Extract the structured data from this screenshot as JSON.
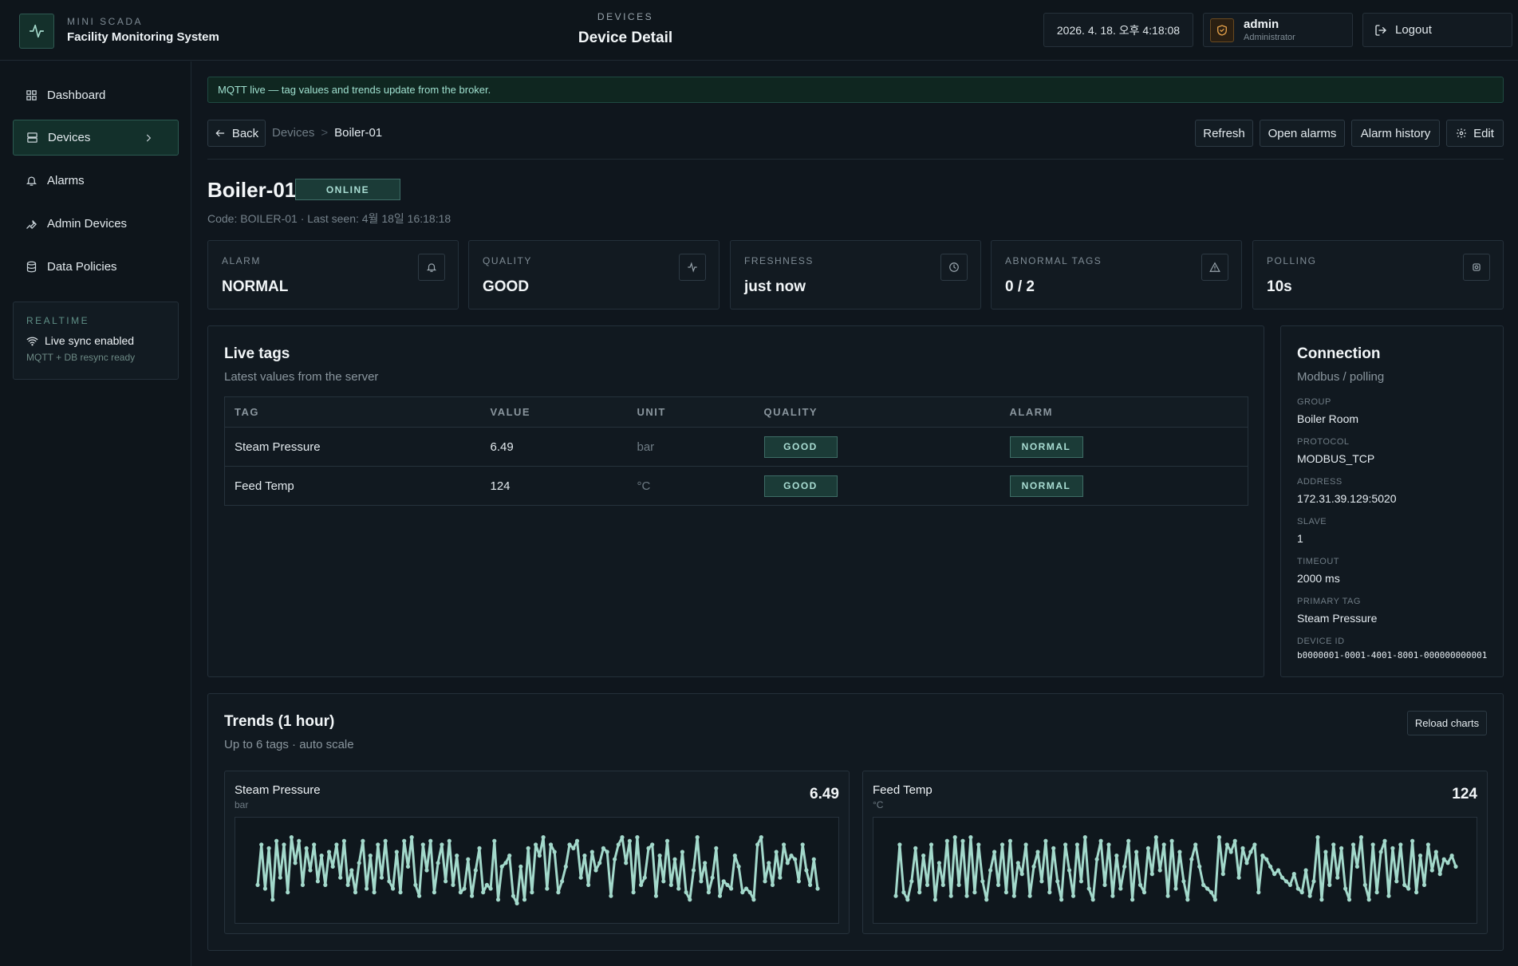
{
  "header": {
    "brand_small": "MINI SCADA",
    "brand_name": "Facility Monitoring System",
    "section": "DEVICES",
    "page_title": "Device Detail",
    "clock": "2026. 4. 18. 오후 4:18:08",
    "user_name": "admin",
    "user_role": "Administrator",
    "logout_label": "Logout"
  },
  "sidebar": {
    "items": [
      {
        "label": "Dashboard",
        "icon": "grid-icon"
      },
      {
        "label": "Devices",
        "icon": "server-icon",
        "active": true
      },
      {
        "label": "Alarms",
        "icon": "bell-icon"
      },
      {
        "label": "Admin Devices",
        "icon": "wrench-icon"
      },
      {
        "label": "Data Policies",
        "icon": "database-icon"
      }
    ],
    "realtime": {
      "title": "REALTIME",
      "status": "Live sync enabled",
      "detail": "MQTT + DB resync ready"
    }
  },
  "banner": "MQTT live — tag values and trends update from the broker.",
  "toolbar": {
    "back": "Back",
    "crumb_parent": "Devices",
    "crumb_sep": ">",
    "crumb_current": "Boiler-01",
    "refresh": "Refresh",
    "open_alarms": "Open alarms",
    "alarm_history": "Alarm history",
    "edit": "Edit"
  },
  "device": {
    "name": "Boiler-01",
    "status": "ONLINE",
    "subtitle": "Code: BOILER-01 · Last seen: 4월 18일 16:18:18"
  },
  "stats": [
    {
      "label": "ALARM",
      "value": "NORMAL",
      "icon": "bell-icon"
    },
    {
      "label": "QUALITY",
      "value": "GOOD",
      "icon": "activity-icon"
    },
    {
      "label": "FRESHNESS",
      "value": "just now",
      "icon": "clock-icon"
    },
    {
      "label": "ABNORMAL TAGS",
      "value": "0 / 2",
      "icon": "warning-icon"
    },
    {
      "label": "POLLING",
      "value": "10s",
      "icon": "gear-icon"
    }
  ],
  "live_tags": {
    "title": "Live tags",
    "subtitle": "Latest values from the server",
    "columns": [
      "TAG",
      "VALUE",
      "UNIT",
      "QUALITY",
      "ALARM"
    ],
    "rows": [
      {
        "tag": "Steam Pressure",
        "value": "6.49",
        "unit": "bar",
        "quality": "GOOD",
        "alarm": "NORMAL"
      },
      {
        "tag": "Feed Temp",
        "value": "124",
        "unit": "°C",
        "quality": "GOOD",
        "alarm": "NORMAL"
      }
    ]
  },
  "connection": {
    "title": "Connection",
    "subtitle": "Modbus / polling",
    "fields": [
      {
        "k": "GROUP",
        "v": "Boiler Room"
      },
      {
        "k": "PROTOCOL",
        "v": "MODBUS_TCP"
      },
      {
        "k": "ADDRESS",
        "v": "172.31.39.129:5020"
      },
      {
        "k": "SLAVE",
        "v": "1"
      },
      {
        "k": "TIMEOUT",
        "v": "2000 ms"
      },
      {
        "k": "PRIMARY TAG",
        "v": "Steam Pressure"
      },
      {
        "k": "DEVICE ID",
        "v": "b0000001-0001-4001-8001-000000000001"
      }
    ]
  },
  "trends": {
    "title": "Trends (1 hour)",
    "subtitle": "Up to 6 tags · auto scale",
    "reload": "Reload charts",
    "line_color": "#a3d9cb"
  },
  "chart_data": [
    {
      "type": "line",
      "title": "Steam Pressure",
      "unit": "bar",
      "current": "6.49",
      "values": [
        0.3,
        0.85,
        0.25,
        0.8,
        0.1,
        0.9,
        0.4,
        0.85,
        0.2,
        0.95,
        0.6,
        0.9,
        0.3,
        0.8,
        0.5,
        0.85,
        0.35,
        0.7,
        0.3,
        0.75,
        0.55,
        0.85,
        0.4,
        0.9,
        0.3,
        0.5,
        0.2,
        0.6,
        0.9,
        0.25,
        0.7,
        0.2,
        0.85,
        0.4,
        0.9,
        0.35,
        0.25,
        0.75,
        0.2,
        0.9,
        0.55,
        0.95,
        0.3,
        0.15,
        0.85,
        0.5,
        0.9,
        0.2,
        0.6,
        0.85,
        0.35,
        0.9,
        0.3,
        0.7,
        0.2,
        0.25,
        0.65,
        0.15,
        0.5,
        0.8,
        0.2,
        0.3,
        0.25,
        0.9,
        0.1,
        0.55,
        0.6,
        0.7,
        0.15,
        0.05,
        0.55,
        0.1,
        0.8,
        0.2,
        0.85,
        0.7,
        0.95,
        0.25,
        0.85,
        0.75,
        0.2,
        0.35,
        0.55,
        0.85,
        0.8,
        0.9,
        0.4,
        0.7,
        0.3,
        0.75,
        0.5,
        0.6,
        0.8,
        0.75,
        0.15,
        0.65,
        0.85,
        0.95,
        0.6,
        0.9,
        0.2,
        0.95,
        0.3,
        0.4,
        0.8,
        0.85,
        0.15,
        0.7,
        0.35,
        0.9,
        0.3,
        0.65,
        0.25,
        0.75,
        0.2,
        0.1,
        0.5,
        0.95,
        0.35,
        0.6,
        0.2,
        0.4,
        0.8,
        0.15,
        0.35,
        0.3,
        0.25,
        0.7,
        0.55,
        0.2,
        0.25,
        0.2,
        0.1,
        0.85,
        0.95,
        0.35,
        0.6,
        0.3,
        0.75,
        0.4,
        0.85,
        0.6,
        0.7,
        0.65,
        0.35,
        0.85,
        0.5,
        0.3,
        0.65,
        0.25
      ]
    },
    {
      "type": "line",
      "title": "Feed Temp",
      "unit": "°C",
      "current": "124",
      "values": [
        0.15,
        0.85,
        0.2,
        0.1,
        0.35,
        0.8,
        0.2,
        0.7,
        0.3,
        0.85,
        0.1,
        0.6,
        0.3,
        0.9,
        0.15,
        0.95,
        0.3,
        0.9,
        0.15,
        0.95,
        0.2,
        0.85,
        0.35,
        0.1,
        0.5,
        0.75,
        0.3,
        0.85,
        0.2,
        0.9,
        0.15,
        0.6,
        0.45,
        0.85,
        0.15,
        0.55,
        0.75,
        0.35,
        0.9,
        0.2,
        0.8,
        0.35,
        0.1,
        0.85,
        0.5,
        0.15,
        0.85,
        0.35,
        0.95,
        0.25,
        0.1,
        0.65,
        0.9,
        0.3,
        0.85,
        0.15,
        0.7,
        0.25,
        0.55,
        0.9,
        0.1,
        0.75,
        0.3,
        0.2,
        0.8,
        0.45,
        0.95,
        0.5,
        0.85,
        0.15,
        0.9,
        0.25,
        0.75,
        0.35,
        0.1,
        0.65,
        0.85,
        0.55,
        0.3,
        0.25,
        0.2,
        0.1,
        0.95,
        0.45,
        0.85,
        0.75,
        0.9,
        0.4,
        0.8,
        0.6,
        0.75,
        0.85,
        0.2,
        0.7,
        0.65,
        0.55,
        0.45,
        0.5,
        0.4,
        0.35,
        0.3,
        0.45,
        0.25,
        0.2,
        0.5,
        0.15,
        0.35,
        0.95,
        0.1,
        0.75,
        0.3,
        0.85,
        0.4,
        0.8,
        0.25,
        0.1,
        0.85,
        0.55,
        0.95,
        0.3,
        0.1,
        0.85,
        0.2,
        0.75,
        0.9,
        0.15,
        0.8,
        0.35,
        0.85,
        0.3,
        0.25,
        0.9,
        0.2,
        0.7,
        0.3,
        0.85,
        0.5,
        0.75,
        0.45,
        0.65,
        0.6,
        0.7,
        0.55
      ]
    }
  ]
}
